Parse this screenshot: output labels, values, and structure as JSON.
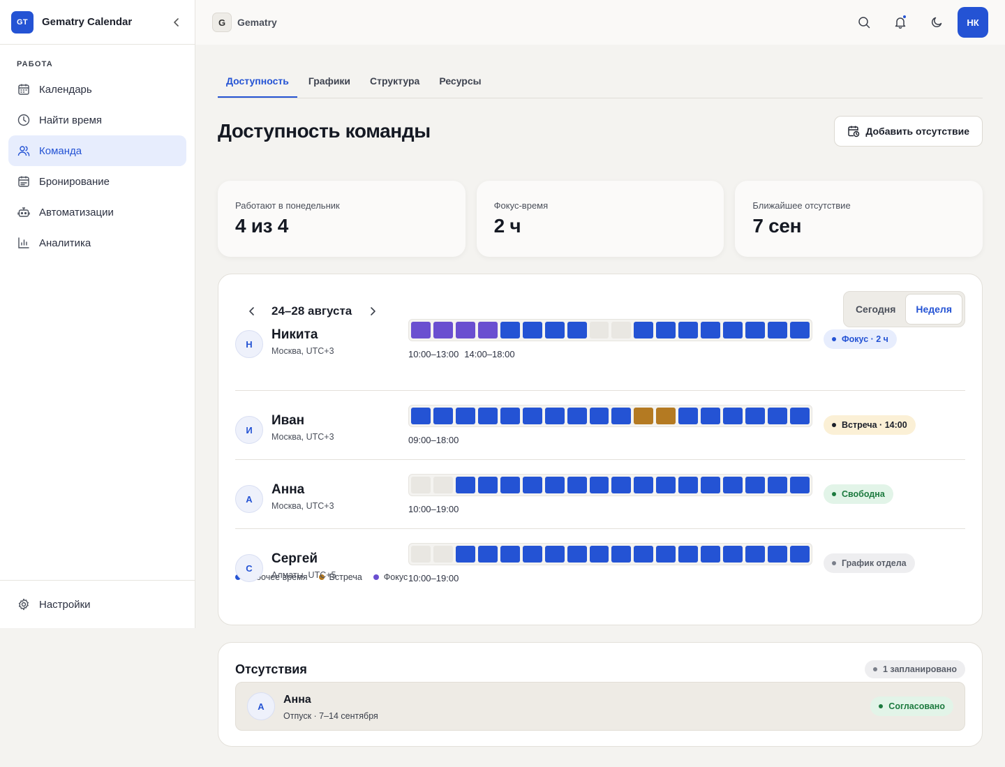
{
  "sidebar": {
    "logo_text": "GT",
    "app_name": "Gematry Calendar",
    "section_label": "РАБОТА",
    "items": [
      {
        "label": "Календарь",
        "icon": "calendar-icon"
      },
      {
        "label": "Найти время",
        "icon": "clock-icon"
      },
      {
        "label": "Команда",
        "icon": "users-icon",
        "active": true
      },
      {
        "label": "Бронирование",
        "icon": "calendar-check-icon"
      },
      {
        "label": "Автоматизации",
        "icon": "robot-icon"
      },
      {
        "label": "Аналитика",
        "icon": "bar-chart-icon"
      }
    ],
    "settings_label": "Настройки"
  },
  "topbar": {
    "workspace_letter": "G",
    "workspace_name": "Gematry",
    "user_initials": "НК"
  },
  "tabs": [
    "Доступность",
    "Графики",
    "Структура",
    "Ресурсы"
  ],
  "page": {
    "title": "Доступность команды",
    "add_button": "Добавить отсутствие"
  },
  "stats": [
    {
      "label": "Работают в понедельник",
      "value": "4 из 4"
    },
    {
      "label": "Фокус-время",
      "value": "2 ч"
    },
    {
      "label": "Ближайшее отсутствие",
      "value": "7 сен"
    }
  ],
  "availability": {
    "week_label": "24–28 августа",
    "view_today": "Сегодня",
    "view_week": "Неделя",
    "people": [
      {
        "initial": "Н",
        "name": "Никита",
        "tz": "Москва, UTC+3",
        "hours": [
          "10:00–13:00",
          "14:00–18:00"
        ],
        "slots": [
          "focus",
          "focus",
          "focus",
          "focus",
          "work",
          "work",
          "work",
          "work",
          "off",
          "off",
          "work",
          "work",
          "work",
          "work",
          "work",
          "work",
          "work",
          "work"
        ],
        "status": "Фокус · 2 ч",
        "status_kind": "blue"
      },
      {
        "initial": "И",
        "name": "Иван",
        "tz": "Москва, UTC+3",
        "hours": [
          "09:00–18:00"
        ],
        "slots": [
          "work",
          "work",
          "work",
          "work",
          "work",
          "work",
          "work",
          "work",
          "work",
          "work",
          "meet",
          "meet",
          "work",
          "work",
          "work",
          "work",
          "work",
          "work"
        ],
        "status": "Встреча · 14:00",
        "status_kind": "amber"
      },
      {
        "initial": "А",
        "name": "Анна",
        "tz": "Москва, UTC+3",
        "hours": [
          "10:00–19:00"
        ],
        "slots": [
          "off",
          "off",
          "work",
          "work",
          "work",
          "work",
          "work",
          "work",
          "work",
          "work",
          "work",
          "work",
          "work",
          "work",
          "work",
          "work",
          "work",
          "work"
        ],
        "status": "Свободна",
        "status_kind": "green"
      },
      {
        "initial": "С",
        "name": "Сергей",
        "tz": "Алматы, UTC+5",
        "hours": [
          "10:00–19:00"
        ],
        "slots": [
          "off",
          "off",
          "work",
          "work",
          "work",
          "work",
          "work",
          "work",
          "work",
          "work",
          "work",
          "work",
          "work",
          "work",
          "work",
          "work",
          "work",
          "work"
        ],
        "status": "График отдела",
        "status_kind": "gray"
      }
    ],
    "legend": [
      {
        "label": "Рабочее время",
        "color": "#2453d4"
      },
      {
        "label": "Встреча",
        "color": "#b47a22"
      },
      {
        "label": "Фокус",
        "color": "#6a4fd0"
      }
    ]
  },
  "absences": {
    "title": "Отсутствия",
    "count_label": "1 запланировано",
    "items": [
      {
        "initial": "А",
        "name": "Анна",
        "detail": "Отпуск · 7–14 сентября",
        "status": "Согласовано"
      }
    ]
  },
  "colors": {
    "accent": "#2453d4",
    "focus": "#6a4fd0",
    "meeting": "#b47a22"
  }
}
